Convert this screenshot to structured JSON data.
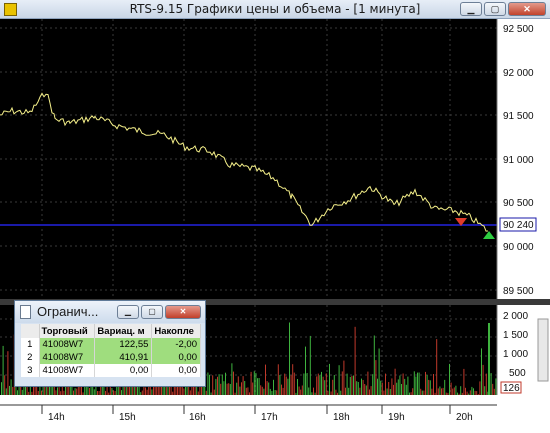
{
  "window": {
    "title": "RTS-9.15 Графики цены и объема - [1 минута]",
    "buttons": {
      "minimize": "▁",
      "maximize": "▢",
      "close": "✕"
    }
  },
  "price_axis": {
    "ticks": [
      "92 500",
      "92 000",
      "91 500",
      "91 000",
      "90 500",
      "90 000",
      "89 500"
    ],
    "current_price": "90 240"
  },
  "volume_axis": {
    "ticks": [
      "2 000",
      "1 500",
      "1 000",
      "500"
    ],
    "current_value": "126"
  },
  "time_axis": {
    "ticks": [
      "14h",
      "15h",
      "16h",
      "17h",
      "18h",
      "19h",
      "20h"
    ]
  },
  "colors": {
    "price_line": "#f5f08a",
    "current_level_line": "#1a1aa8",
    "volume_up": "#3fb33f",
    "volume_down": "#c0392b",
    "buy_marker": "#2ecc40",
    "sell_marker": "#e03b2b"
  },
  "table_window": {
    "title": "Огранич...",
    "columns": [
      "",
      "Торговый",
      "Вариац. м",
      "Накопле"
    ],
    "rows": [
      {
        "index": "1",
        "account": "41008W7",
        "variation": "122,55",
        "accumulated": "-2,00"
      },
      {
        "index": "2",
        "account": "41008W7",
        "variation": "410,91",
        "accumulated": "0,00"
      },
      {
        "index": "3",
        "account": "41008W7",
        "variation": "0,00",
        "accumulated": "0,00"
      }
    ]
  }
}
